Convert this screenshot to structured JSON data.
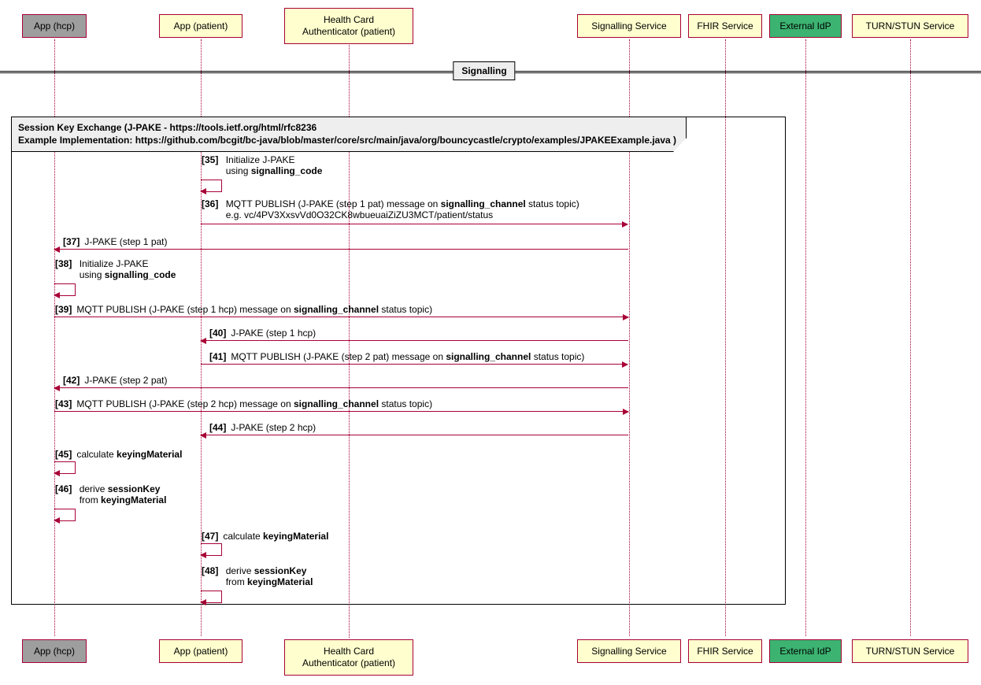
{
  "participants": {
    "app_hcp": "App (hcp)",
    "app_patient": "App (patient)",
    "hca_patient": "Health Card\nAuthenticator (patient)",
    "signalling": "Signalling Service",
    "fhir": "FHIR Service",
    "idp": "External IdP",
    "turn": "TURN/STUN Service"
  },
  "divider": {
    "label": "Signalling"
  },
  "fragment": {
    "title_line1": "Session Key Exchange (J-PAKE - https://tools.ietf.org/html/rfc8236",
    "title_line2": "Example Implementation: https://github.com/bcgit/bc-java/blob/master/core/src/main/java/org/bouncycastle/crypto/examples/JPAKEExample.java )"
  },
  "msgs": {
    "m35_num": "[35]",
    "m35_l1": "Initialize J-PAKE",
    "m35_l2a": "using ",
    "m35_l2b": "signalling_code",
    "m36_num": "[36]",
    "m36_l1a": "MQTT PUBLISH (J-PAKE (step 1 pat) message on ",
    "m36_l1b": "signalling_channel",
    "m36_l1c": " status topic)",
    "m36_l2": "e.g. vc/4PV3XxsvVd0O32CK8wbueuaiZiZU3MCT/patient/status",
    "m37_num": "[37]",
    "m37": "J-PAKE (step 1 pat)",
    "m38_num": "[38]",
    "m38_l1": "Initialize J-PAKE",
    "m38_l2a": "using ",
    "m38_l2b": "signalling_code",
    "m39_num": "[39]",
    "m39a": "MQTT PUBLISH (J-PAKE (step 1 hcp) message on ",
    "m39b": "signalling_channel",
    "m39c": " status topic)",
    "m40_num": "[40]",
    "m40": "J-PAKE (step 1 hcp)",
    "m41_num": "[41]",
    "m41a": "MQTT PUBLISH (J-PAKE (step 2 pat) message on ",
    "m41b": "signalling_channel",
    "m41c": " status topic)",
    "m42_num": "[42]",
    "m42": "J-PAKE (step 2 pat)",
    "m43_num": "[43]",
    "m43a": "MQTT PUBLISH (J-PAKE (step 2 hcp) message on ",
    "m43b": "signalling_channel",
    "m43c": " status topic)",
    "m44_num": "[44]",
    "m44": "J-PAKE (step 2 hcp)",
    "m45_num": "[45]",
    "m45a": "calculate ",
    "m45b": "keyingMaterial",
    "m46_num": "[46]",
    "m46_l1a": "derive ",
    "m46_l1b": "sessionKey",
    "m46_l2a": "from ",
    "m46_l2b": "keyingMaterial",
    "m47_num": "[47]",
    "m47a": "calculate ",
    "m47b": "keyingMaterial",
    "m48_num": "[48]",
    "m48_l1a": "derive ",
    "m48_l1b": "sessionKey",
    "m48_l2a": "from ",
    "m48_l2b": "keyingMaterial"
  }
}
